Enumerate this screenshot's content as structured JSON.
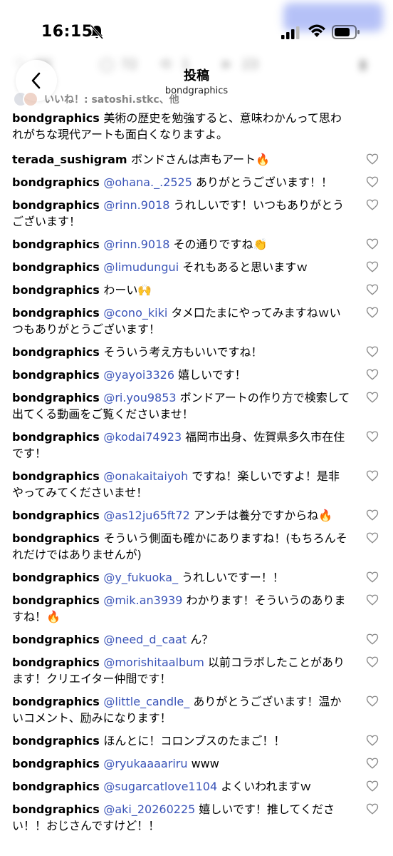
{
  "status_bar": {
    "time": "16:15"
  },
  "header": {
    "title": "投稿",
    "subtitle": "bondgraphics"
  },
  "blurred_row": {
    "count_a": "8K",
    "count_b": "72",
    "count_c": "1",
    "count_d": "23"
  },
  "likes_row": {
    "text": "いいね！: satoshi.stkc、他"
  },
  "comments": [
    {
      "user": "bondgraphics",
      "mention": "",
      "text": "美術の歴史を勉強すると、意味わかんって思われがちな現代アートも面白くなりますよ。",
      "heart": false
    },
    {
      "user": "terada_sushigram",
      "mention": "",
      "text": "ボンドさんは声もアート🔥",
      "heart": true
    },
    {
      "user": "bondgraphics",
      "mention": "@ohana._.2525",
      "text": "ありがとうございます！！",
      "heart": true
    },
    {
      "user": "bondgraphics",
      "mention": "@rinn.9018",
      "text": "うれしいです！いつもありがとうございます！",
      "heart": true
    },
    {
      "user": "bondgraphics",
      "mention": "@rinn.9018",
      "text": "その通りですね👏",
      "heart": true
    },
    {
      "user": "bondgraphics",
      "mention": "@limudungui",
      "text": "それもあると思いますｗ",
      "heart": true
    },
    {
      "user": "bondgraphics",
      "mention": "",
      "text": "わーい🙌",
      "heart": true
    },
    {
      "user": "bondgraphics",
      "mention": "@cono_kiki",
      "text": "タメ口たまにやってみますねｗいつもありがとうございます！",
      "heart": true
    },
    {
      "user": "bondgraphics",
      "mention": "",
      "text": "そういう考え方もいいですね！",
      "heart": true
    },
    {
      "user": "bondgraphics",
      "mention": "@yayoi3326",
      "text": "嬉しいです！",
      "heart": true
    },
    {
      "user": "bondgraphics",
      "mention": "@ri.you9853",
      "text": "ボンドアートの作り方で検索して出てくる動画をご覧くださいませ！",
      "heart": true
    },
    {
      "user": "bondgraphics",
      "mention": "@kodai74923",
      "text": "福岡市出身、佐賀県多久市在住です！",
      "heart": true
    },
    {
      "user": "bondgraphics",
      "mention": "@onakaitaiyoh",
      "text": "ですね！楽しいですよ！是非やってみてくださいませ！",
      "heart": true
    },
    {
      "user": "bondgraphics",
      "mention": "@as12ju65ft72",
      "text": "アンチは養分ですからね🔥",
      "heart": true
    },
    {
      "user": "bondgraphics",
      "mention": "",
      "text": "そういう側面も確かにありますね！(もちろんそれだけではありませんが)",
      "heart": true
    },
    {
      "user": "bondgraphics",
      "mention": "@y_fukuoka_",
      "text": "うれしいですー！！",
      "heart": true
    },
    {
      "user": "bondgraphics",
      "mention": "@mik.an3939",
      "text": "わかります！そういうのありますね！🔥",
      "heart": true
    },
    {
      "user": "bondgraphics",
      "mention": "@need_d_caat",
      "text": "ん？",
      "heart": true
    },
    {
      "user": "bondgraphics",
      "mention": "@morishitaalbum",
      "text": "以前コラボしたことがあります！クリエイター仲間です！",
      "heart": true
    },
    {
      "user": "bondgraphics",
      "mention": "@little_candle_",
      "text": "ありがとうございます！温かいコメント、励みになります！",
      "heart": true
    },
    {
      "user": "bondgraphics",
      "mention": "",
      "text": "ほんとに！コロンブスのたまご！！",
      "heart": true
    },
    {
      "user": "bondgraphics",
      "mention": "@ryukaaaariru",
      "text": "www",
      "heart": true
    },
    {
      "user": "bondgraphics",
      "mention": "@sugarcatlove1104",
      "text": "よくいわれますｗ",
      "heart": true
    },
    {
      "user": "bondgraphics",
      "mention": "@aki_20260225",
      "text": "嬉しいです！推してください！！おじさんですけど！！",
      "heart": true
    }
  ]
}
